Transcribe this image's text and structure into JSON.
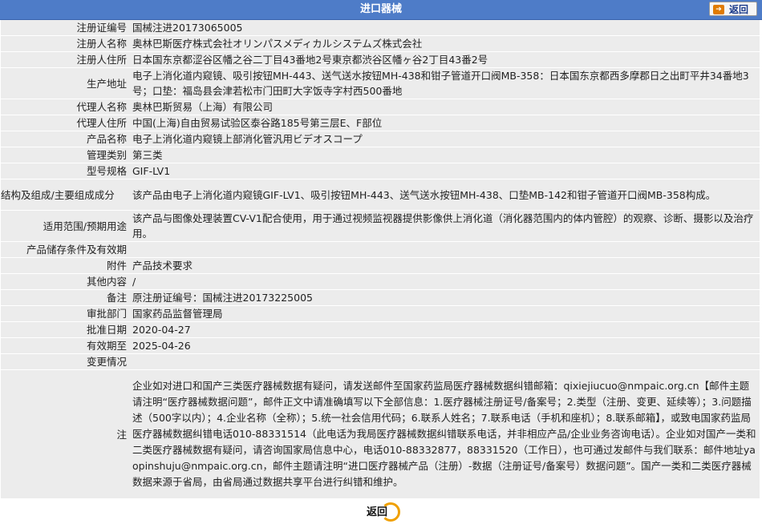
{
  "header": {
    "title": "进口器械",
    "back_label": "返回"
  },
  "rows": [
    {
      "label": "注册证编号",
      "value": "国械注进20173065005"
    },
    {
      "label": "注册人名称",
      "value": "奥林巴斯医疗株式会社オリンパスメディカルシステムズ株式会社"
    },
    {
      "label": "注册人住所",
      "value": "日本国东京都涩谷区幡之谷二丁目43番地2号東京都渋谷区幡ヶ谷2丁目43番2号"
    },
    {
      "label": "生产地址",
      "value": "电子上消化道内窥镜、吸引按钮MH-443、送气送水按钮MH-438和钳子管道开口阀MB-358：日本国东京都西多摩郡日之出町平井34番地3号；口垫：福岛县会津若松市门田町大字饭寺字村西500番地"
    },
    {
      "label": "代理人名称",
      "value": "奥林巴斯贸易（上海）有限公司"
    },
    {
      "label": "代理人住所",
      "value": "中国(上海)自由贸易试验区泰谷路185号第三层E、F部位"
    },
    {
      "label": "产品名称",
      "value": "电子上消化道内窥镜上部消化管汎用ビデオスコープ"
    },
    {
      "label": "管理类别",
      "value": "第三类"
    },
    {
      "label": "型号规格",
      "value": "GIF-LV1"
    },
    {
      "label": "结构及组成/主要组成成分",
      "value": "该产品由电子上消化道内窥镜GIF-LV1、吸引按钮MH-443、送气送水按钮MH-438、口垫MB-142和钳子管道开口阀MB-358构成。"
    },
    {
      "label": "适用范围/预期用途",
      "value": "该产品与图像处理装置CV-V1配合使用，用于通过视频监视器提供影像供上消化道（消化器范围内的体内管腔）的观察、诊断、摄影以及治疗用。"
    },
    {
      "label": "产品储存条件及有效期",
      "value": ""
    },
    {
      "label": "附件",
      "value": "产品技术要求"
    },
    {
      "label": "其他内容",
      "value": "/"
    },
    {
      "label": "备注",
      "value": "原注册证编号：国械注进20173225005"
    },
    {
      "label": "审批部门",
      "value": "国家药品监督管理局"
    },
    {
      "label": "批准日期",
      "value": "2020-04-27"
    },
    {
      "label": "有效期至",
      "value": "2025-04-26"
    },
    {
      "label": "变更情况",
      "value": ""
    }
  ],
  "note": {
    "label": "注",
    "text": "企业如对进口和国产三类医疗器械数据有疑问，请发送邮件至国家药监局医疗器械数据纠错邮箱：qixiejiucuo@nmpaic.org.cn【邮件主题请注明“医疗器械数据问题”，邮件正文中请准确填写以下全部信息：1.医疗器械注册证号/备案号；2.类型（注册、变更、延续等）；3.问题描述（500字以内）；4.企业名称（全称）；5.统一社会信用代码；6.联系人姓名；7.联系电话（手机和座机）；8.联系邮箱】，或致电国家药监局医疗器械数据纠错电话010-88331514（此电话为我局医疗器械数据纠错联系电话，并非相应产品/企业业务咨询电话）。企业如对国产一类和二类医疗器械数据有疑问，请咨询国家局信息中心，电话010-88332877，88331520（工作日），也可通过发邮件与我们联系：邮件地址yaopinshuju@nmpaic.org.cn，邮件主题请注明“进口医疗器械产品（注册）-数据（注册证号/备案号）数据问题”。国产一类和二类医疗器械数据来源于省局，由省局通过数据共享平台进行纠错和维护。"
  },
  "footer": {
    "back_label": "返回"
  },
  "colors": {
    "header_bg": "#4e7cc8",
    "row_shade": "#ececec",
    "accent": "#f0a000"
  }
}
